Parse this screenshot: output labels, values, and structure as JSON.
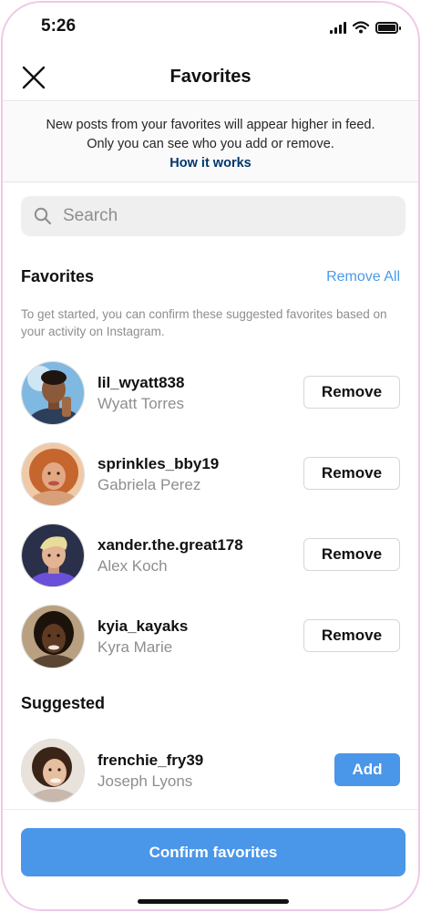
{
  "status_bar": {
    "time": "5:26"
  },
  "header": {
    "title": "Favorites"
  },
  "info": {
    "line1": "New posts from your favorites will appear higher in feed.",
    "line2": "Only you can see who you add or remove.",
    "link": "How it works"
  },
  "search": {
    "placeholder": "Search"
  },
  "favorites": {
    "title": "Favorites",
    "remove_all": "Remove All",
    "hint": "To get started, you can confirm these suggested favorites based on your activity on Instagram.",
    "users": [
      {
        "username": "lil_wyatt838",
        "name": "Wyatt Torres",
        "action": "Remove"
      },
      {
        "username": "sprinkles_bby19",
        "name": "Gabriela Perez",
        "action": "Remove"
      },
      {
        "username": "xander.the.great178",
        "name": "Alex Koch",
        "action": "Remove"
      },
      {
        "username": "kyia_kayaks",
        "name": "Kyra Marie",
        "action": "Remove"
      }
    ]
  },
  "suggested": {
    "title": "Suggested",
    "users": [
      {
        "username": "frenchie_fry39",
        "name": "Joseph Lyons",
        "action": "Add"
      }
    ]
  },
  "footer": {
    "confirm_label": "Confirm favorites"
  },
  "colors": {
    "accent": "#4a96e9",
    "link": "#00376b",
    "secondary_text": "#8e8e8e",
    "remove_all": "#4a9be8"
  }
}
